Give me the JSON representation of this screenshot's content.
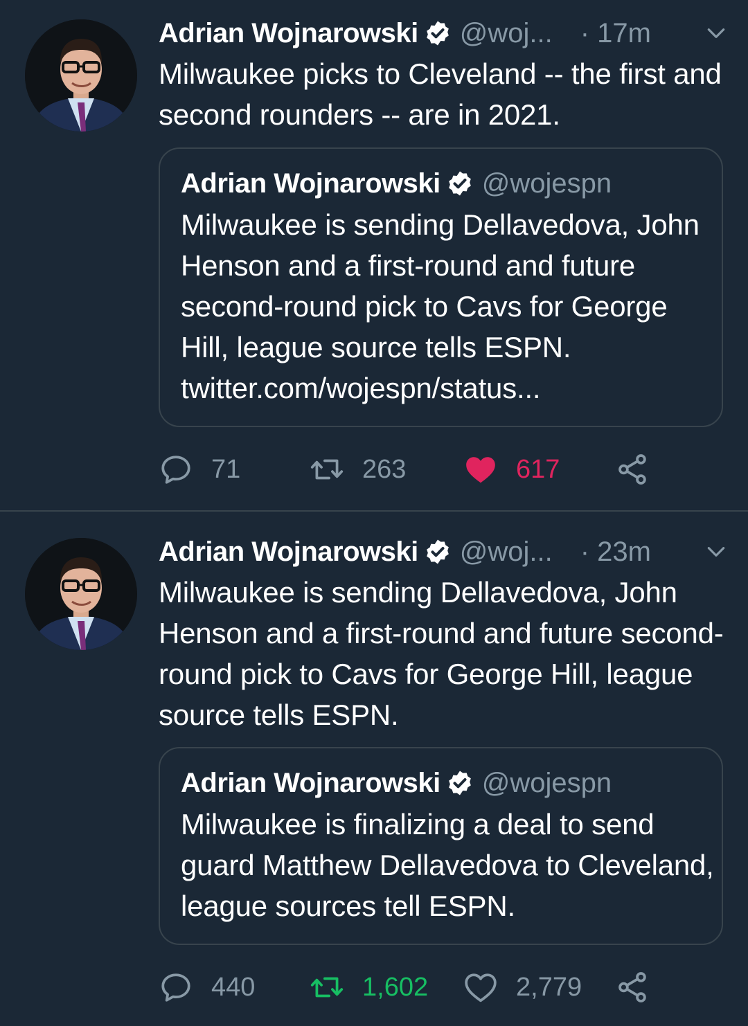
{
  "colors": {
    "background": "#1b2836",
    "secondary_text": "#8899a6",
    "border": "#38444d",
    "like_active": "#e0245e",
    "retweet_active": "#17bf63",
    "verified_badge": "#ffffff"
  },
  "tweets": [
    {
      "author_name": "Adrian Wojnarowski",
      "author_handle": "@woj...",
      "time": "· 17m",
      "text": "Milwaukee picks to Cleveland -- the first and second rounders -- are in 2021.",
      "quote": {
        "author_name": "Adrian Wojnarowski",
        "author_handle": "@wojespn",
        "text": "Milwaukee is sending Dellavedova, John Henson and a first-round and future second-round pick to Cavs for George Hill, league source tells ESPN.",
        "link": "twitter.com/wojespn/status..."
      },
      "actions": {
        "replies": "71",
        "retweets": "263",
        "likes": "617",
        "liked": true,
        "retweeted": false
      },
      "icons": [
        "verified-icon",
        "chevron-down-icon",
        "reply-icon",
        "retweet-icon",
        "heart-icon",
        "share-icon"
      ]
    },
    {
      "author_name": "Adrian Wojnarowski",
      "author_handle": "@woj...",
      "time": "· 23m",
      "text": "Milwaukee is sending Dellavedova, John Henson and a first-round and future second-round pick to Cavs for George Hill, league source tells ESPN.",
      "quote": {
        "author_name": "Adrian Wojnarowski",
        "author_handle": "@wojespn",
        "text": "Milwaukee is finalizing a deal to send guard Matthew Dellavedova to Cleveland, league sources tell ESPN."
      },
      "actions": {
        "replies": "440",
        "retweets": "1,602",
        "likes": "2,779",
        "liked": false,
        "retweeted": true
      },
      "icons": [
        "verified-icon",
        "chevron-down-icon",
        "reply-icon",
        "retweet-icon",
        "heart-outline-icon",
        "share-icon"
      ]
    }
  ]
}
